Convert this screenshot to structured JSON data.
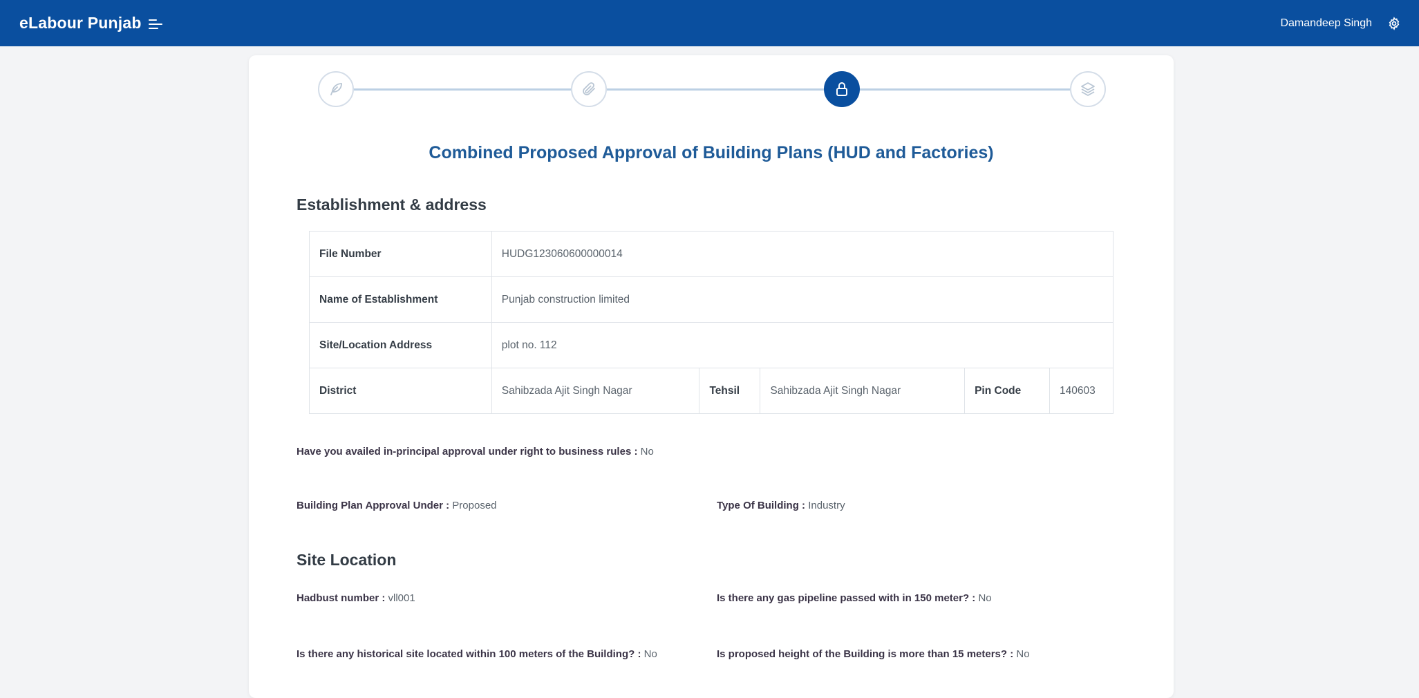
{
  "header": {
    "brand": "eLabour Punjab",
    "user_name": "Damandeep Singh"
  },
  "stepper": {
    "steps": [
      {
        "icon": "feather-icon",
        "active": false
      },
      {
        "icon": "paperclip-icon",
        "active": false
      },
      {
        "icon": "lock-icon",
        "active": true
      },
      {
        "icon": "layers-icon",
        "active": false
      }
    ]
  },
  "form": {
    "title": "Combined Proposed Approval of Building Plans (HUD and Factories)",
    "section1_title": "Establishment & address",
    "table": {
      "file_number_label": "File Number",
      "file_number": "HUDG123060600000014",
      "establishment_label": "Name of Establishment",
      "establishment": "Punjab construction limited",
      "address_label": "Site/Location Address",
      "address": "plot no. 112",
      "district_label": "District",
      "district": "Sahibzada Ajit Singh Nagar",
      "tehsil_label": "Tehsil",
      "tehsil": "Sahibzada Ajit Singh Nagar",
      "pincode_label": "Pin Code",
      "pincode": "140603"
    },
    "in_principal_label": "Have you availed in-principal approval under right to business rules :",
    "in_principal_value": "No",
    "approval_under_label": "Building Plan Approval Under :",
    "approval_under_value": "Proposed",
    "building_type_label": "Type Of Building :",
    "building_type_value": "Industry",
    "section2_title": "Site Location",
    "hadbust_label": "Hadbust number :",
    "hadbust_value": "vll001",
    "gas_label": "Is there any gas pipeline passed with in 150 meter? :",
    "gas_value": "No",
    "historical_label": "Is there any historical site located within 100 meters of the Building? :",
    "historical_value": "No",
    "height_label": "Is proposed height of the Building is more than 15 meters? :",
    "height_value": "No"
  },
  "colors": {
    "primary": "#0a4f9f",
    "title": "#1f5b98",
    "background": "#f3f4f6"
  }
}
